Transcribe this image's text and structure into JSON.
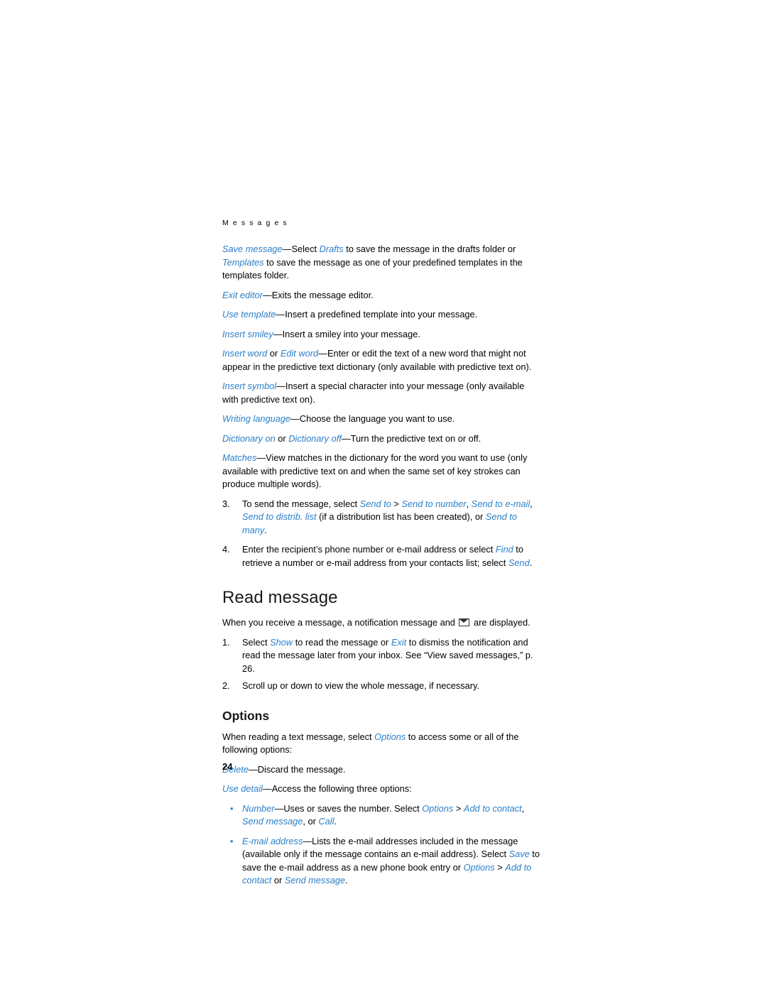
{
  "document": {
    "running_head": "M e s s a g e s",
    "page_number": "24",
    "accent_color": "#2a7fc9",
    "body_color": "#000000"
  },
  "options_list_top": [
    {
      "id": "save-message",
      "segments": [
        {
          "text": "Save message",
          "style": "term"
        },
        {
          "text": "—Select ",
          "style": "plain"
        },
        {
          "text": "Drafts",
          "style": "term"
        },
        {
          "text": " to save the message in the drafts folder or ",
          "style": "plain"
        },
        {
          "text": "Templates",
          "style": "term"
        },
        {
          "text": " to save the message as one of your predefined templates in the templates folder.",
          "style": "plain"
        }
      ]
    },
    {
      "id": "exit-editor",
      "segments": [
        {
          "text": "Exit editor",
          "style": "term"
        },
        {
          "text": "—Exits the message editor.",
          "style": "plain"
        }
      ]
    },
    {
      "id": "use-template",
      "segments": [
        {
          "text": "Use template",
          "style": "term"
        },
        {
          "text": "—Insert a predefined template into your message.",
          "style": "plain"
        }
      ]
    },
    {
      "id": "insert-smiley",
      "segments": [
        {
          "text": "Insert smiley",
          "style": "term"
        },
        {
          "text": "—Insert a smiley into your message.",
          "style": "plain"
        }
      ]
    },
    {
      "id": "insert-word",
      "segments": [
        {
          "text": "Insert word",
          "style": "term"
        },
        {
          "text": " or ",
          "style": "plain"
        },
        {
          "text": "Edit word",
          "style": "term"
        },
        {
          "text": "—Enter or edit the text of a new word that might not appear in the predictive text dictionary (only available with predictive text on).",
          "style": "plain"
        }
      ]
    },
    {
      "id": "insert-symbol",
      "segments": [
        {
          "text": "Insert symbol",
          "style": "term"
        },
        {
          "text": "—Insert a special character into your message (only available with predictive text on).",
          "style": "plain"
        }
      ]
    },
    {
      "id": "writing-language",
      "segments": [
        {
          "text": "Writing language",
          "style": "term"
        },
        {
          "text": "—Choose the language you want to use.",
          "style": "plain"
        }
      ]
    },
    {
      "id": "dictionary-on-off",
      "segments": [
        {
          "text": "Dictionary on",
          "style": "term"
        },
        {
          "text": " or ",
          "style": "plain"
        },
        {
          "text": "Dictionary off",
          "style": "term"
        },
        {
          "text": "—Turn the predictive text on or off.",
          "style": "plain"
        }
      ]
    },
    {
      "id": "matches",
      "segments": [
        {
          "text": "Matches",
          "style": "term"
        },
        {
          "text": "—View matches in the dictionary for the word you want to use (only available with predictive text on and when the same set of key strokes can produce multiple words).",
          "style": "plain"
        }
      ]
    }
  ],
  "numbered_steps_top": [
    {
      "number": "3.",
      "segments": [
        {
          "text": "To send the message, select ",
          "style": "plain"
        },
        {
          "text": "Send to",
          "style": "term"
        },
        {
          "text": " > ",
          "style": "plain"
        },
        {
          "text": "Send to number",
          "style": "term"
        },
        {
          "text": ", ",
          "style": "plain"
        },
        {
          "text": "Send to e-mail",
          "style": "term"
        },
        {
          "text": ", ",
          "style": "plain"
        },
        {
          "text": "Send to distrib. list",
          "style": "term"
        },
        {
          "text": " (if a distribution list has been created), or ",
          "style": "plain"
        },
        {
          "text": "Send to many",
          "style": "term"
        },
        {
          "text": ".",
          "style": "plain"
        }
      ]
    },
    {
      "number": "4.",
      "segments": [
        {
          "text": "Enter the recipient’s phone number or e-mail address or select ",
          "style": "plain"
        },
        {
          "text": "Find",
          "style": "term"
        },
        {
          "text": " to retrieve a number or e-mail address from your contacts list; select ",
          "style": "plain"
        },
        {
          "text": "Send",
          "style": "term"
        },
        {
          "text": ".",
          "style": "plain"
        }
      ]
    }
  ],
  "read_message": {
    "heading": "Read message",
    "intro_before_icon": "When you receive a message, a notification message and ",
    "intro_after_icon": " are displayed.",
    "steps": [
      {
        "number": "1.",
        "segments": [
          {
            "text": "Select ",
            "style": "plain"
          },
          {
            "text": "Show",
            "style": "term"
          },
          {
            "text": " to read the message or ",
            "style": "plain"
          },
          {
            "text": "Exit",
            "style": "term"
          },
          {
            "text": " to dismiss the notification and read the message later from your inbox. See “View saved messages,” p. 26.",
            "style": "plain"
          }
        ]
      },
      {
        "number": "2.",
        "segments": [
          {
            "text": "Scroll up or down to view the whole message, if necessary.",
            "style": "plain"
          }
        ]
      }
    ]
  },
  "options_section": {
    "heading": "Options",
    "intro": [
      {
        "text": "When reading a text message, select ",
        "style": "plain"
      },
      {
        "text": "Options",
        "style": "term"
      },
      {
        "text": " to access some or all of the following options:",
        "style": "plain"
      }
    ],
    "items": [
      {
        "id": "delete",
        "segments": [
          {
            "text": "Delete",
            "style": "term"
          },
          {
            "text": "—Discard the message.",
            "style": "plain"
          }
        ]
      },
      {
        "id": "use-detail",
        "segments": [
          {
            "text": "Use detail",
            "style": "term"
          },
          {
            "text": "—Access the following three options:",
            "style": "plain"
          }
        ]
      }
    ],
    "bullets": [
      {
        "id": "number",
        "segments": [
          {
            "text": "Number",
            "style": "term"
          },
          {
            "text": "—Uses or saves the number. Select ",
            "style": "plain"
          },
          {
            "text": "Options",
            "style": "term"
          },
          {
            "text": " > ",
            "style": "plain"
          },
          {
            "text": "Add to contact",
            "style": "term"
          },
          {
            "text": ", ",
            "style": "plain"
          },
          {
            "text": "Send message",
            "style": "term"
          },
          {
            "text": ", or ",
            "style": "plain"
          },
          {
            "text": "Call",
            "style": "term"
          },
          {
            "text": ".",
            "style": "plain"
          }
        ]
      },
      {
        "id": "e-mail-address",
        "segments": [
          {
            "text": "E-mail address",
            "style": "term"
          },
          {
            "text": "—Lists the e-mail addresses included in the message (available only if the message contains an e-mail address). Select ",
            "style": "plain"
          },
          {
            "text": "Save",
            "style": "term"
          },
          {
            "text": " to save the e-mail address as a new phone book entry or ",
            "style": "plain"
          },
          {
            "text": "Options",
            "style": "term"
          },
          {
            "text": " > ",
            "style": "plain"
          },
          {
            "text": "Add to contact",
            "style": "term"
          },
          {
            "text": " or ",
            "style": "plain"
          },
          {
            "text": "Send message",
            "style": "term"
          },
          {
            "text": ".",
            "style": "plain"
          }
        ]
      }
    ]
  }
}
